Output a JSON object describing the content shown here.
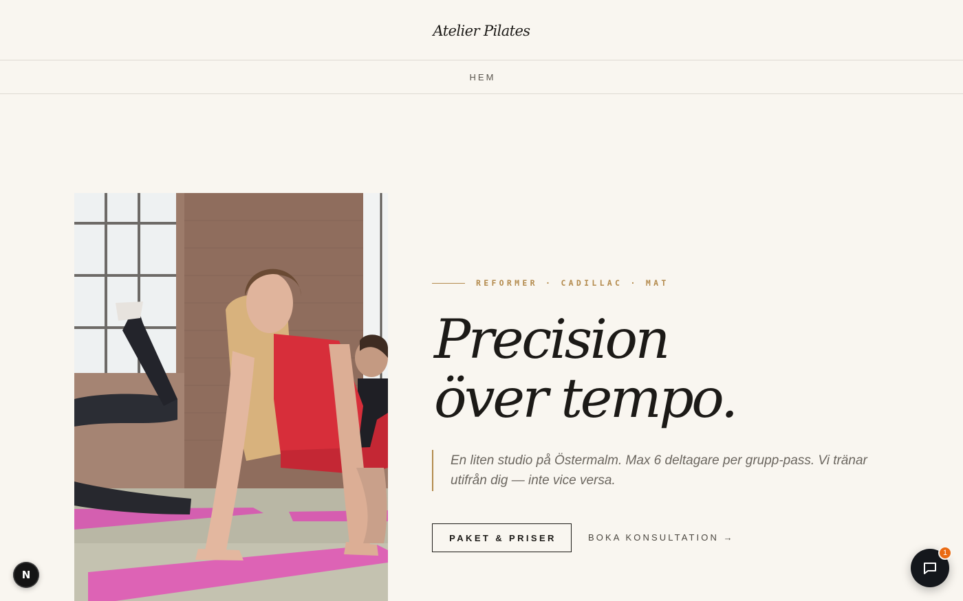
{
  "header": {
    "brand": "Atelier Pilates"
  },
  "nav": {
    "items": [
      {
        "label": "HEM"
      }
    ]
  },
  "hero": {
    "eyebrow": "REFORMER · CADILLAC · MAT",
    "headline_line1": "Precision",
    "headline_line2": "över tempo.",
    "quote": "En liten studio på Östermalm. Max 6 deltagare per grupp-pass. Vi tränar utifrån dig — inte vice versa.",
    "primary_cta": "PAKET & PRISER",
    "secondary_cta": "BOKA KONSULTATION →"
  },
  "dev_badge": {
    "letter": "N"
  },
  "chat": {
    "notification_count": "1"
  },
  "colors": {
    "background": "#f9f6f0",
    "accent": "#b38a4c",
    "text": "#1c1a17",
    "chat_badge": "#ea6a12"
  },
  "icons": {
    "chat": "chat-bubble-icon",
    "arrow": "arrow-right"
  }
}
